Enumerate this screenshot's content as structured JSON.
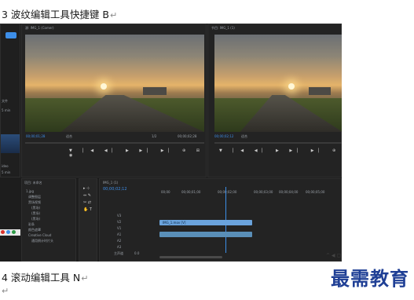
{
  "document": {
    "heading_1": "3 波纹编辑工具快捷键 B",
    "heading_2": "4 滚动编辑工具 N",
    "paragraph_mark": "↵",
    "watermark": "最需教育"
  },
  "app": {
    "source_monitor": {
      "title": "源: IMG_1 (Comer)",
      "timecode_left": "00;00;01;28",
      "timecode_right": "00;00;02;28",
      "zoom": "适合",
      "fraction": "1/2"
    },
    "program_monitor": {
      "title": "节目: IMG_1 (1)",
      "timecode_left": "00;00;02;12",
      "zoom": "适合"
    },
    "project_panel": {
      "tab": "项目: 未命名",
      "items": [
        "1.jpg",
        "调整图层",
        "黑场视频",
        "(黑场)",
        "(黑场)",
        "(黑场)",
        "彩条",
        "颜色遮罩",
        "Creative Cloud",
        "通用倒计时片头"
      ]
    },
    "timeline": {
      "tab": "IMG_1 (1)",
      "timecode": "00;00;02;12",
      "ruler": [
        "00;00",
        "00;00;01;00",
        "00;00;02;00",
        "00;00;03;00",
        "00;00;04;00",
        "00;00;05;00"
      ],
      "clip_video": "IMG_1.mov [V]",
      "clip_audio": "",
      "tracks": [
        "V3",
        "V2",
        "V1",
        "A1",
        "A2",
        "A3"
      ],
      "master": "主声道",
      "master_value": "0.0"
    },
    "left_edge_labels": [
      "文件",
      "5 min",
      "5 min",
      "ideo",
      "5 min"
    ]
  },
  "colors": {
    "accent": "#3d8ee8",
    "clip_video": "#6aa3dc",
    "clip_audio": "#5a8fb8",
    "watermark": "#1f3f95"
  }
}
